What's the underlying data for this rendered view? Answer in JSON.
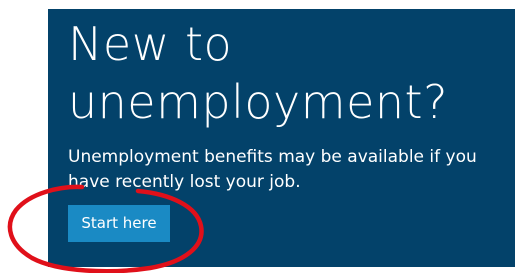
{
  "hero": {
    "title_line1": "New to",
    "title_line2": "unemployment?",
    "description": "Unemployment benefits may be available if you have recently lost your job.",
    "button_label": "Start here"
  },
  "colors": {
    "panel_background": "#03426a",
    "button_background": "#1a8ac4",
    "annotation_circle": "#e0101a"
  }
}
